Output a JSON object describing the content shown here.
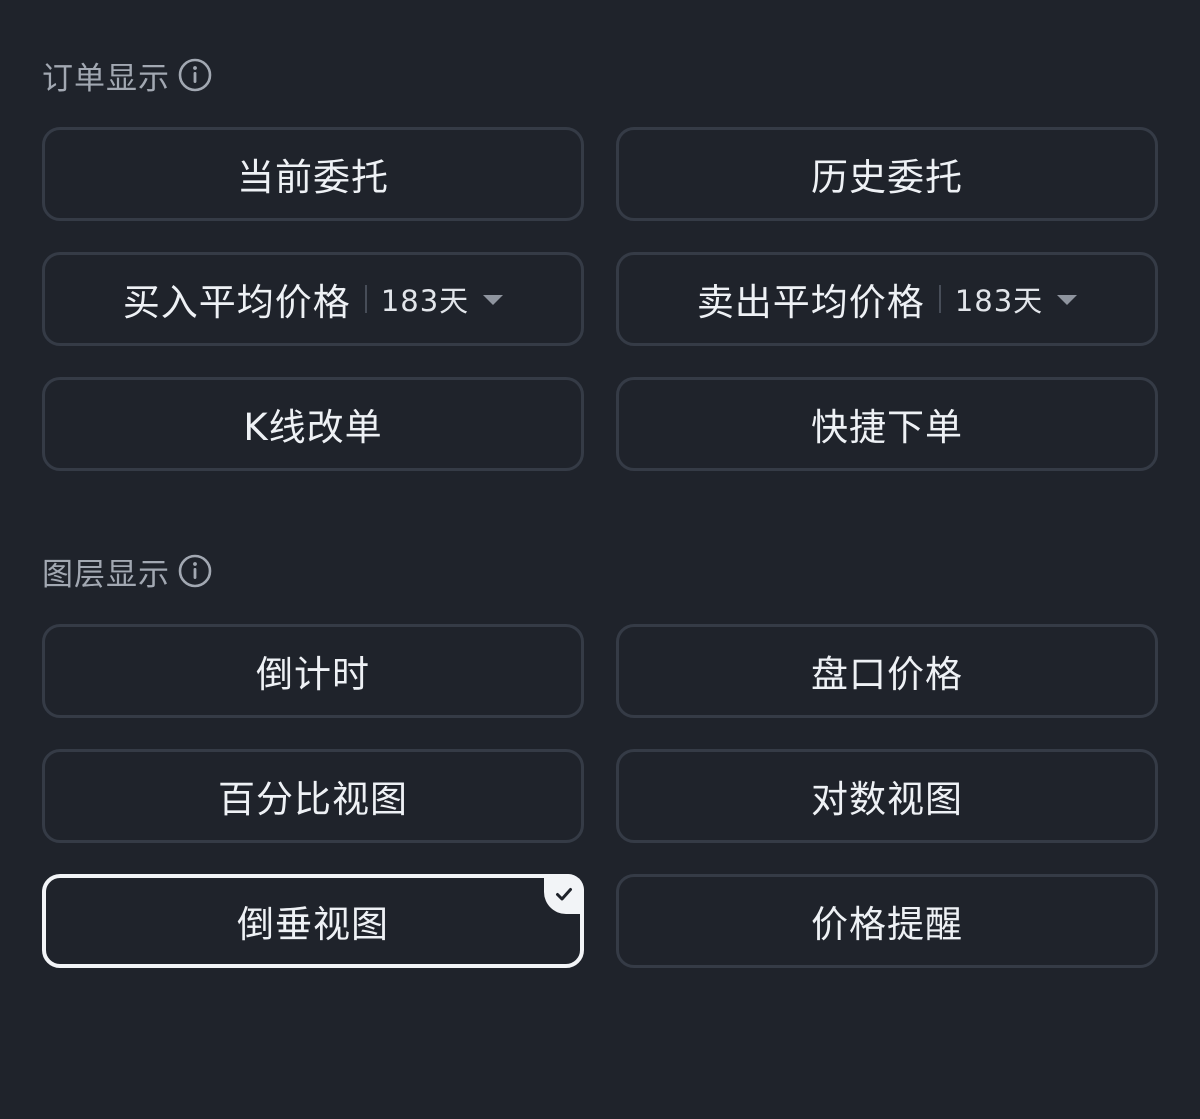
{
  "sections": {
    "orders": {
      "title": "订单显示",
      "info_icon": "info-icon",
      "options": [
        {
          "label": "当前委托",
          "selected": false
        },
        {
          "label": "历史委托",
          "selected": false
        },
        {
          "label": "买入平均价格",
          "period": "183天",
          "has_dropdown": true,
          "selected": false
        },
        {
          "label": "卖出平均价格",
          "period": "183天",
          "has_dropdown": true,
          "selected": false
        },
        {
          "label": "K线改单",
          "selected": false
        },
        {
          "label": "快捷下单",
          "selected": false
        }
      ]
    },
    "layers": {
      "title": "图层显示",
      "info_icon": "info-icon",
      "options": [
        {
          "label": "倒计时",
          "selected": false
        },
        {
          "label": "盘口价格",
          "selected": false
        },
        {
          "label": "百分比视图",
          "selected": false
        },
        {
          "label": "对数视图",
          "selected": false
        },
        {
          "label": "倒垂视图",
          "selected": true,
          "check_icon": "check-icon"
        },
        {
          "label": "价格提醒",
          "selected": false
        }
      ]
    }
  },
  "colors": {
    "background": "#1f232b",
    "tile_border": "#353b46",
    "selected_border": "#f2f4f7",
    "text_primary": "#eef1f5",
    "text_secondary": "#a2a8b2",
    "caret": "#8e949e"
  }
}
